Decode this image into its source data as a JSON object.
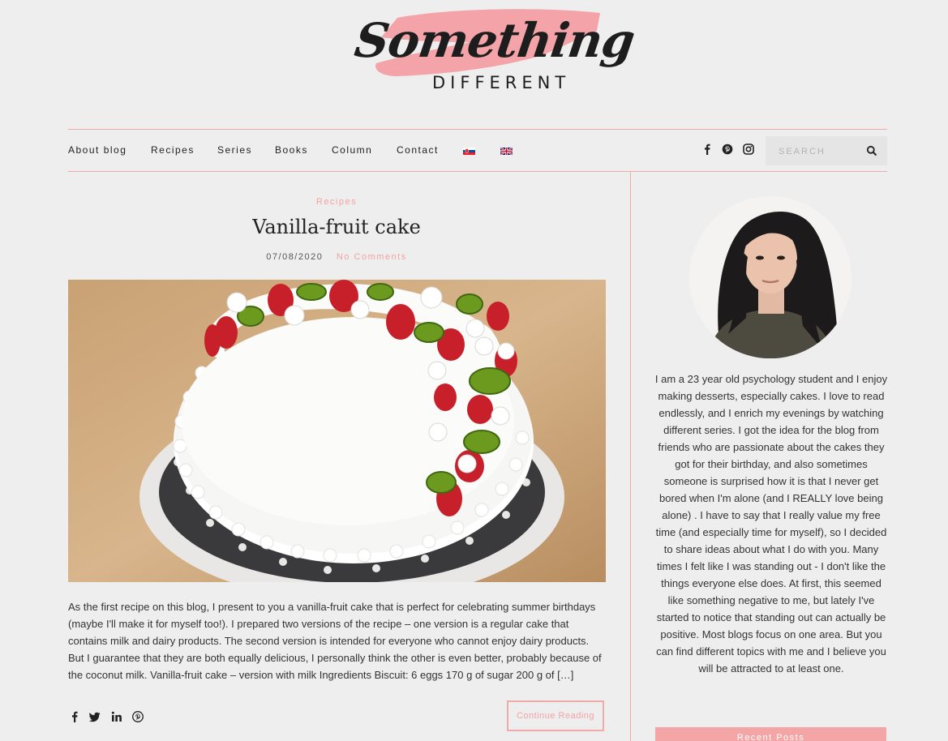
{
  "logo": {
    "word": "Something",
    "sub": "DIFFERENT"
  },
  "nav": {
    "items": [
      "About blog",
      "Recipes",
      "Series",
      "Books",
      "Column",
      "Contact"
    ],
    "flags": [
      "slovak-flag-icon",
      "uk-flag-icon"
    ],
    "social": [
      "facebook-icon",
      "pinterest-icon",
      "instagram-icon"
    ],
    "search_placeholder": "SEARCH"
  },
  "post": {
    "category": "Recipes",
    "title": "Vanilla-fruit cake",
    "date": "07/08/2020",
    "comments": "No Comments",
    "excerpt": "As the first recipe on this blog, I present to you a vanilla-fruit cake that is perfect for celebrating summer birthdays (maybe I'll make it for myself too!). I prepared two versions of the recipe – one version is a regular cake that contains milk and dairy products. The second version is intended for everyone who cannot enjoy dairy products. But I guarantee that they are both equally delicious, I personally think the other is even better, probably because of the coconut milk. Vanilla-fruit cake – version with milk Ingredients Biscuit: 6 eggs 170 g of sugar 200 g of […]",
    "share": [
      "facebook-icon",
      "twitter-icon",
      "linkedin-icon",
      "pinterest-icon"
    ],
    "continue_label": "Continue Reading"
  },
  "sidebar": {
    "bio": "I am a 23 year old psychology student and I enjoy making desserts, especially cakes. I love to read endlessly, and I enrich my evenings by watching different series. I got the idea for the blog from friends who are passionate about the cakes they got for their birthday, and also sometimes someone is surprised how it is that I never get bored when I'm alone (and I REALLY love being alone) . I have to say that I really value my free time (and especially time for myself), so I decided to share ideas about what I do with you. Many times I felt like I was standing out - I don't like the things everyone else does. At first, this seemed like something negative to me, but lately I've started to notice that standing out can actually be positive. Most blogs focus on one area. But you can find different topics with me and I believe you will be attracted to at least one.",
    "widget_title": "Recent Posts"
  },
  "colors": {
    "accent": "#f0a3a3",
    "background": "#efeeee",
    "text": "#222222"
  }
}
